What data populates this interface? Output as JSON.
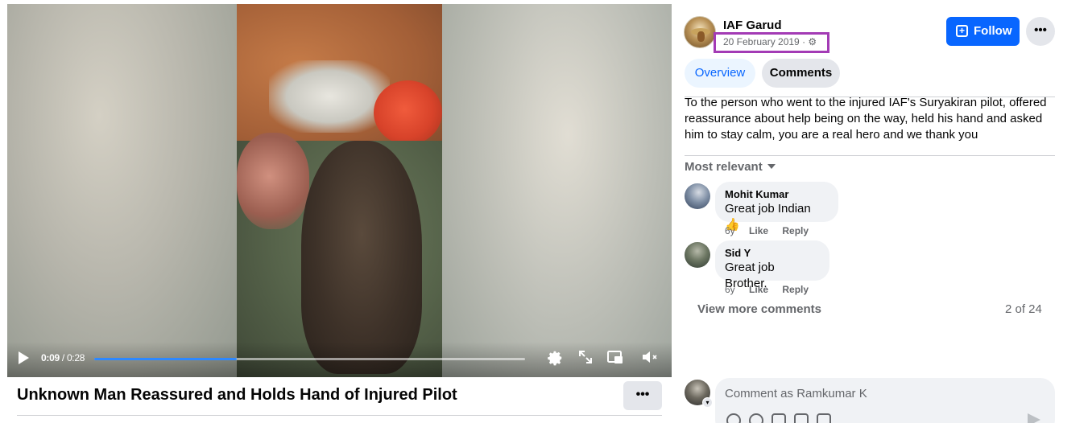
{
  "video": {
    "current_time": "0:09",
    "separator": " / ",
    "duration": "0:28",
    "progress_fraction": 0.33,
    "title": "Unknown Man Reassured and Holds Hand of Injured Pilot"
  },
  "post": {
    "page_name": "IAF Garud",
    "date": "20 February 2019",
    "date_separator": " · ",
    "text": "To the person who went to the injured IAF's Suryakiran pilot, offered reassurance about help being on the way, held his hand and asked him to stay calm, you are a real hero and we thank you",
    "follow_label": "Follow",
    "more_label": "•••"
  },
  "tabs": [
    {
      "label": "Overview",
      "active": true
    },
    {
      "label": "Comments",
      "active": false
    }
  ],
  "comments": {
    "sort_label": "Most relevant",
    "items": [
      {
        "author": "Mohit Kumar",
        "text": "Great job Indian 👍",
        "age": "6y",
        "like": "Like",
        "reply": "Reply"
      },
      {
        "author": "Sid Y",
        "text": "Great job Brother.",
        "age": "6y",
        "like": "Like",
        "reply": "Reply"
      }
    ],
    "view_more_label": "View more comments",
    "count_label": "2 of 24",
    "input_placeholder": "Comment as Ramkumar K"
  },
  "colors": {
    "accent": "#0866ff",
    "highlight_box": "#a33bb5",
    "progress_fill": "#2d88ff"
  },
  "icons": [
    "play-icon",
    "settings-icon",
    "fullscreen-icon",
    "picture-in-picture-icon",
    "mute-icon",
    "more-icon",
    "follow-icon",
    "gear-icon",
    "caret-down-icon",
    "send-icon"
  ]
}
